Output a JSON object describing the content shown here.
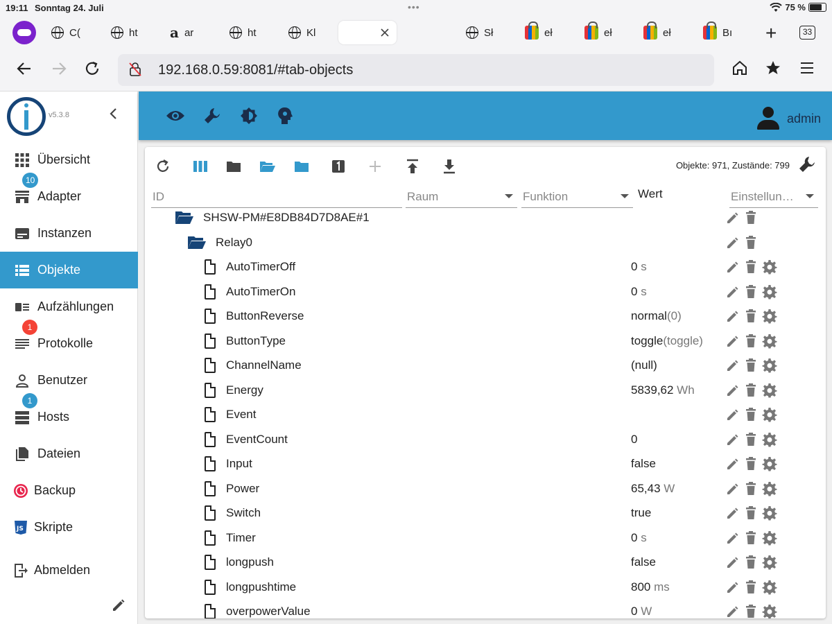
{
  "status": {
    "time": "19:11",
    "date": "Sonntag 24. Juli",
    "battery": "75 %"
  },
  "tabs": [
    {
      "label": "C(",
      "icon": "globe-icon"
    },
    {
      "label": "ht",
      "icon": "globe-icon"
    },
    {
      "label": "ar",
      "icon": "amazon-icon"
    },
    {
      "label": "ht",
      "icon": "globe-icon"
    },
    {
      "label": "Kl",
      "icon": "globe-icon"
    },
    {
      "label": "",
      "icon": "blank-icon",
      "active": true
    },
    {
      "label": "Sł",
      "icon": "globe-icon"
    },
    {
      "label": "eł",
      "icon": "ebay-bag-icon"
    },
    {
      "label": "eł",
      "icon": "ebay-bag-icon"
    },
    {
      "label": "eł",
      "icon": "ebay-bag-icon"
    },
    {
      "label": "Bı",
      "icon": "ebay-bag-icon"
    }
  ],
  "tab_count": "33",
  "url": "192.168.0.59:8081/#tab-objects",
  "sidebar": {
    "version": "v5.3.8",
    "items": [
      {
        "label": "Übersicht",
        "icon": "grid-icon"
      },
      {
        "label": "Adapter",
        "icon": "store-icon",
        "badge": "10",
        "badge_color": "#3399cc"
      },
      {
        "label": "Instanzen",
        "icon": "instances-icon"
      },
      {
        "label": "Objekte",
        "icon": "list-icon",
        "active": true
      },
      {
        "label": "Aufzählungen",
        "icon": "enum-icon"
      },
      {
        "label": "Protokolle",
        "icon": "log-icon",
        "badge": "1",
        "badge_color": "#f44336"
      },
      {
        "label": "Benutzer",
        "icon": "user-icon"
      },
      {
        "label": "Hosts",
        "icon": "hosts-icon",
        "badge": "1",
        "badge_color": "#3399cc"
      },
      {
        "label": "Dateien",
        "icon": "files-icon"
      },
      {
        "label": "Backup",
        "icon": "backup-icon"
      },
      {
        "label": "Skripte",
        "icon": "js-icon"
      },
      {
        "label": "Abmelden",
        "icon": "logout-icon"
      }
    ]
  },
  "appbar": {
    "user": "admin"
  },
  "objects": {
    "stats": "Objekte: 971, Zustände: 799",
    "columns": {
      "id": "ID",
      "room": "Raum",
      "function": "Funktion",
      "value": "Wert",
      "settings": "Einstellun…"
    },
    "rows": [
      {
        "name": "SHSW-PM#E8DB84D7D8AE#1",
        "type": "folder",
        "level": 0,
        "value": "",
        "unit": ""
      },
      {
        "name": "Relay0",
        "type": "folder",
        "level": 1,
        "value": "",
        "unit": ""
      },
      {
        "name": "AutoTimerOff",
        "type": "state",
        "value": "0",
        "unit": " s"
      },
      {
        "name": "AutoTimerOn",
        "type": "state",
        "value": "0",
        "unit": " s"
      },
      {
        "name": "ButtonReverse",
        "type": "state",
        "value": "normal",
        "unit": "(0)"
      },
      {
        "name": "ButtonType",
        "type": "state",
        "value": "toggle",
        "unit": "(toggle)"
      },
      {
        "name": "ChannelName",
        "type": "state",
        "value": "(null)",
        "unit": ""
      },
      {
        "name": "Energy",
        "type": "state",
        "value": "5839,62",
        "unit": " Wh"
      },
      {
        "name": "Event",
        "type": "state",
        "value": "",
        "unit": ""
      },
      {
        "name": "EventCount",
        "type": "state",
        "value": "0",
        "unit": ""
      },
      {
        "name": "Input",
        "type": "state",
        "value": "false",
        "unit": ""
      },
      {
        "name": "Power",
        "type": "state",
        "value": "65,43",
        "unit": " W"
      },
      {
        "name": "Switch",
        "type": "state",
        "value": "true",
        "unit": ""
      },
      {
        "name": "Timer",
        "type": "state",
        "value": "0",
        "unit": " s"
      },
      {
        "name": "longpush",
        "type": "state",
        "value": "false",
        "unit": ""
      },
      {
        "name": "longpushtime",
        "type": "state",
        "value": "800",
        "unit": " ms"
      },
      {
        "name": "overpowerValue",
        "type": "state",
        "value": "0",
        "unit": " W"
      }
    ]
  }
}
